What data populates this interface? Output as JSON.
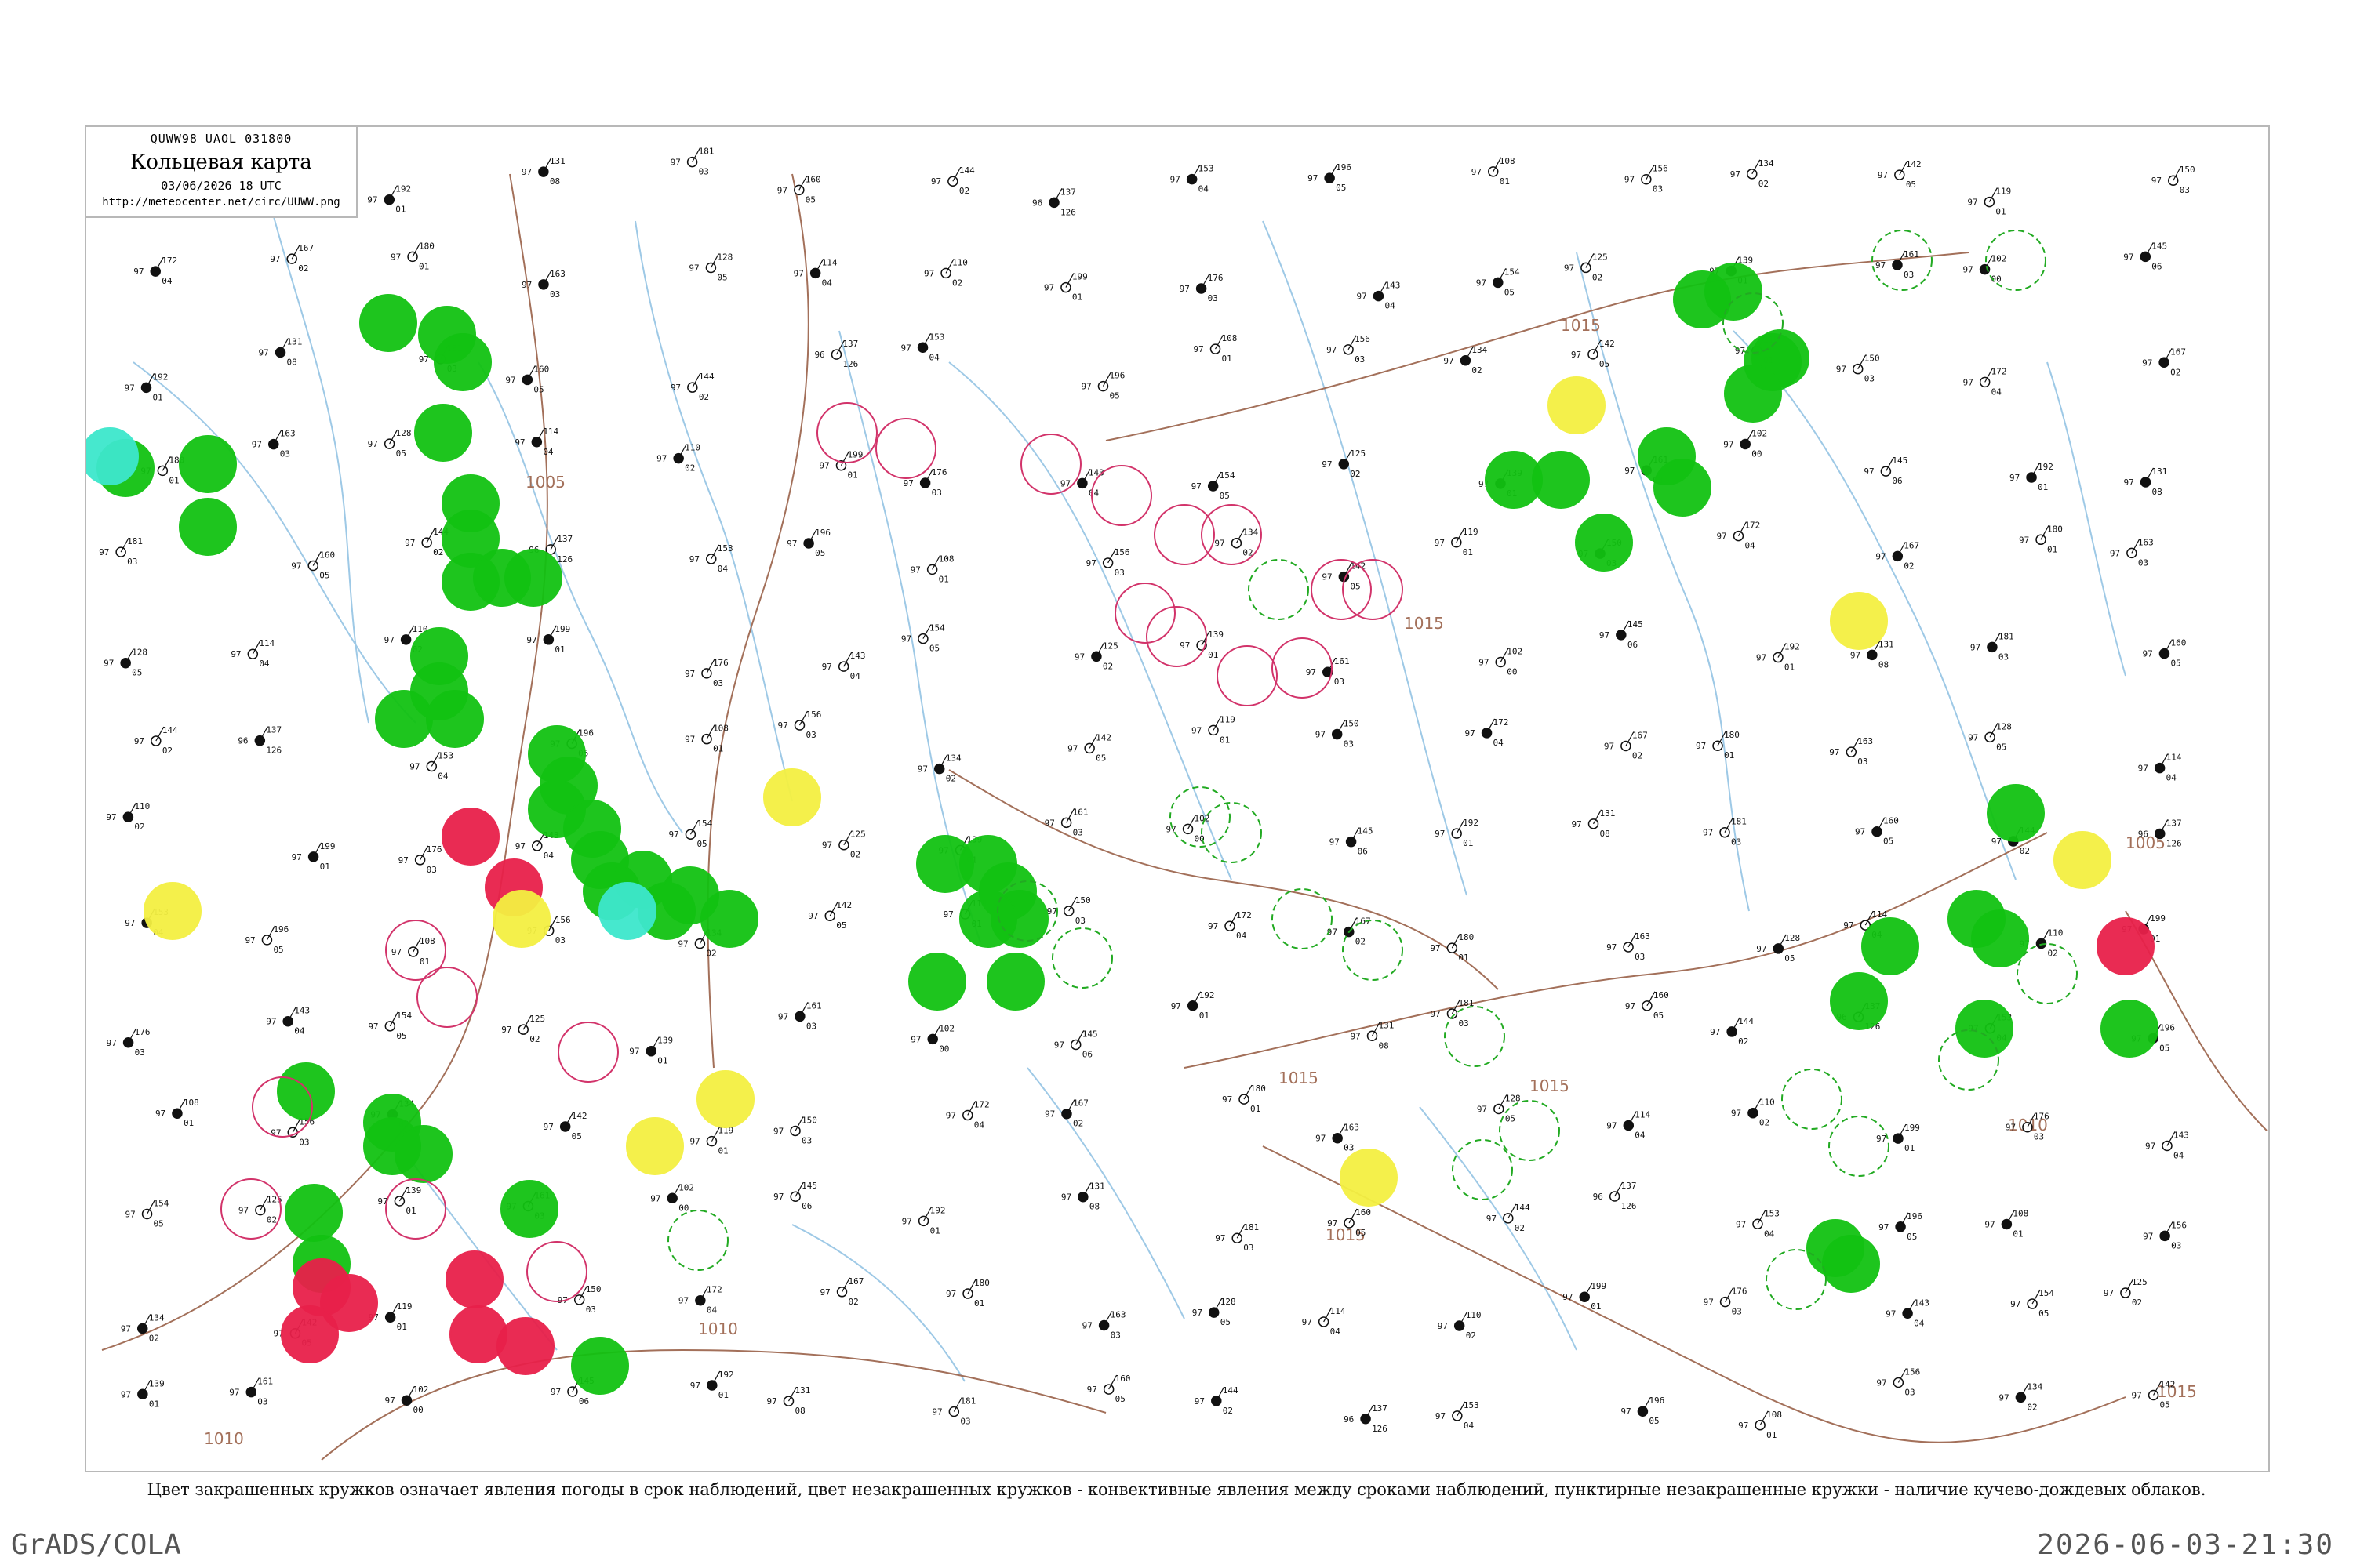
{
  "legend": {
    "code": "QUWW98  UAOL  031800",
    "title": "Кольцевая карта",
    "date": "03/06/2026 18 UTC",
    "url": "http://meteocenter.net/circ/UUWW.png"
  },
  "caption": "Цвет закрашенных кружков означает явления погоды в срок наблюдений, цвет незакрашенных кружков - конвективные явления между сроками наблюдений, пунктирные незакрашенные кружки - наличие кучево-дождевых облаков.",
  "footer": {
    "left": "GrADS/COLA",
    "right": "2026-06-03-21:30"
  },
  "colors": {
    "rain": "#12c212",
    "thunder": "#e8204a",
    "fog": "#f4f042",
    "snow": "#3de7cc",
    "cb_ring": "#22aa22",
    "storm_ring": "#d2336a",
    "isobar": "#a3705a",
    "river": "#9ec9e6",
    "border": "#b8b8b8"
  },
  "isobar_labels": [
    {
      "text": "1005",
      "near": "west"
    },
    {
      "text": "1010",
      "near": "south-west"
    },
    {
      "text": "1010",
      "near": "south"
    },
    {
      "text": "1015",
      "near": "north-east"
    },
    {
      "text": "1015",
      "near": "center-east"
    },
    {
      "text": "1015",
      "near": "center"
    },
    {
      "text": "1015",
      "near": "south-center"
    },
    {
      "text": "1015",
      "near": "east"
    },
    {
      "text": "1005",
      "near": "far-east"
    },
    {
      "text": "1010",
      "near": "far-east-south"
    },
    {
      "text": "1015",
      "near": "south-east"
    }
  ],
  "stations": [
    {
      "p": "102",
      "t": "97",
      "d": "00"
    },
    {
      "p": "145",
      "t": "97",
      "d": "06"
    },
    {
      "p": "192",
      "t": "97",
      "d": "01"
    },
    {
      "p": "131",
      "t": "97",
      "d": "08"
    },
    {
      "p": "181",
      "t": "97",
      "d": "03"
    },
    {
      "p": "160",
      "t": "97",
      "d": "05"
    },
    {
      "p": "144",
      "t": "97",
      "d": "02"
    },
    {
      "p": "137",
      "t": "96",
      "d": "126"
    },
    {
      "p": "153",
      "t": "97",
      "d": "04"
    },
    {
      "p": "196",
      "t": "97",
      "d": "05"
    },
    {
      "p": "108",
      "t": "97",
      "d": "01"
    },
    {
      "p": "156",
      "t": "97",
      "d": "03"
    },
    {
      "p": "134",
      "t": "97",
      "d": "02"
    },
    {
      "p": "142",
      "t": "97",
      "d": "05"
    },
    {
      "p": "119",
      "t": "97",
      "d": "01"
    },
    {
      "p": "150",
      "t": "97",
      "d": "03"
    },
    {
      "p": "172",
      "t": "97",
      "d": "04"
    },
    {
      "p": "167",
      "t": "97",
      "d": "02"
    },
    {
      "p": "180",
      "t": "97",
      "d": "01"
    },
    {
      "p": "163",
      "t": "97",
      "d": "03"
    },
    {
      "p": "128",
      "t": "97",
      "d": "05"
    },
    {
      "p": "114",
      "t": "97",
      "d": "04"
    },
    {
      "p": "110",
      "t": "97",
      "d": "02"
    },
    {
      "p": "199",
      "t": "97",
      "d": "01"
    },
    {
      "p": "176",
      "t": "97",
      "d": "03"
    },
    {
      "p": "143",
      "t": "97",
      "d": "04"
    },
    {
      "p": "154",
      "t": "97",
      "d": "05"
    },
    {
      "p": "125",
      "t": "97",
      "d": "02"
    },
    {
      "p": "139",
      "t": "97",
      "d": "01"
    },
    {
      "p": "161",
      "t": "97",
      "d": "03"
    }
  ]
}
